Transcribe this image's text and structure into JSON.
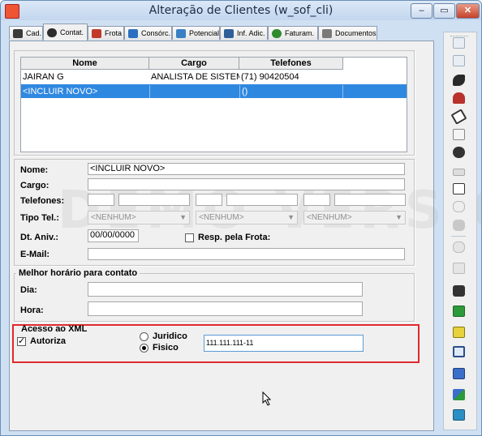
{
  "window": {
    "title": "Alteração de Clientes (w_sof_cli)",
    "buttons": {
      "minimize": "‒",
      "maximize": "▭",
      "close": "✕"
    }
  },
  "tabs": [
    {
      "label": "Cad.",
      "icon": "person-run-icon",
      "color": "#3a3a3a"
    },
    {
      "label": "Contat.",
      "icon": "telephone-icon",
      "color": "#2c2c2c"
    },
    {
      "label": "Frota",
      "icon": "tools-icon",
      "color": "#c0392b"
    },
    {
      "label": "Consórc.",
      "icon": "group-icon",
      "color": "#2c6fbf"
    },
    {
      "label": "Potencial",
      "icon": "grid-icon",
      "color": "#3b7fc4"
    },
    {
      "label": "Inf. Adic.",
      "icon": "chart-icon",
      "color": "#2f5f9a"
    },
    {
      "label": "Faturam.",
      "icon": "money-bag-icon",
      "color": "#2e8b2e"
    },
    {
      "label": "Documentos",
      "icon": "document-icon",
      "color": "#7a7a7a"
    }
  ],
  "active_tab": "Contat.",
  "contacts_table": {
    "headers": [
      "Nome",
      "Cargo",
      "Telefones"
    ],
    "rows": [
      [
        "JAIRAN G",
        "ANALISTA DE SISTEMAS",
        "(71) 90420504"
      ],
      [
        "<INCLUIR NOVO>",
        "",
        "()"
      ]
    ]
  },
  "form": {
    "nome_label": "Nome:",
    "nome_value": "<INCLUIR NOVO>",
    "cargo_label": "Cargo:",
    "cargo_value": "",
    "telefones_label": "Telefones:",
    "tipo_tel_label": "Tipo Tel.:",
    "tipo_tel_options": [
      "<NENHUM>",
      "<NENHUM>",
      "<NENHUM>"
    ],
    "dt_aniv_label": "Dt. Aniv.:",
    "dt_aniv_value": "00/00/0000",
    "resp_frota_label": "Resp. pela Frota:",
    "email_label": "E-Mail:",
    "email_value": ""
  },
  "horario": {
    "title": "Melhor horário para contato",
    "dia_label": "Dia:",
    "dia_value": "",
    "hora_label": "Hora:",
    "hora_value": ""
  },
  "xml": {
    "title": "Acesso ao XML",
    "autoriza_label": "Autoriza",
    "autoriza_checked": "✓",
    "juridico_label": "Juridico",
    "fisico_label": "Fisico",
    "cpf_value": "111.111.111-11"
  },
  "watermark": "DEMO VERSION",
  "toolbar": [
    "grid-add-icon",
    "grid-edit-icon",
    "pen-icon",
    "person-icon",
    "eraser-icon",
    "doc-search-icon",
    "money-icon",
    "truck-icon",
    "copy-icon",
    "chat-icon",
    "stop-icon",
    "link-icon",
    "doc-pen-icon",
    "machines-icon",
    "excel-icon",
    "note-icon",
    "window-copy-icon",
    "align-icon",
    "chart-up-icon",
    "exit-icon"
  ],
  "colors": {
    "selection": "#2f88e0",
    "highlight_box": "#e02a2a",
    "window_border": "#6b8fb8"
  }
}
